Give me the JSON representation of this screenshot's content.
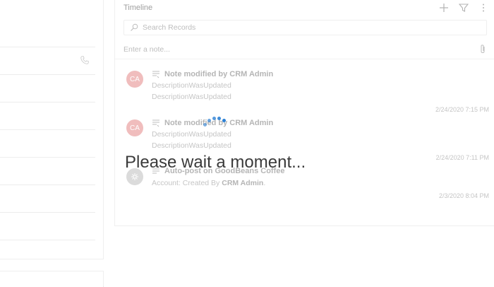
{
  "timeline": {
    "title": "Timeline",
    "search_placeholder": "Search Records",
    "note_placeholder": "Enter a note...",
    "toolbar": {
      "add_icon": "plus-icon",
      "filter_icon": "filter-icon",
      "more_icon": "more-vertical-icon"
    },
    "entries": [
      {
        "avatar_initials": "CA",
        "title": "Note modified by CRM Admin",
        "lines": [
          "DescriptionWasUpdated",
          "DescriptionWasUpdated"
        ],
        "timestamp": "2/24/2020 7:15 PM"
      },
      {
        "avatar_initials": "CA",
        "title": "Note modified by CRM Admin",
        "lines": [
          "DescriptionWasUpdated",
          "DescriptionWasUpdated"
        ],
        "timestamp": "2/24/2020 7:11 PM"
      },
      {
        "avatar_initials": "",
        "title": "Auto-post on GoodBeans Coffee",
        "line_prefix": "Account: Created By",
        "line_user": "CRM Admin",
        "line_suffix": ".",
        "timestamp": "2/3/2020 8:04 PM"
      }
    ]
  },
  "loading": {
    "message": "Please wait a moment..."
  },
  "colors": {
    "accent": "#2a7fd4",
    "avatar": "#e89a9a"
  }
}
